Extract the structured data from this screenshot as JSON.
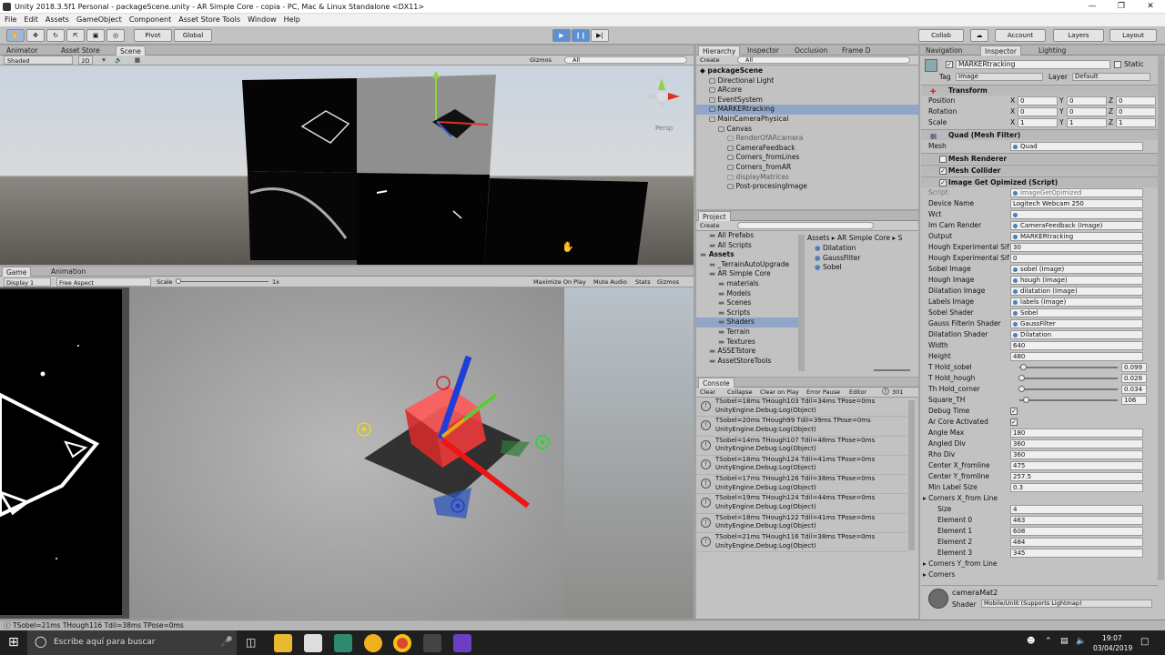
{
  "window": {
    "title": "Unity 2018.3.5f1 Personal - packageScene.unity - AR Simple Core - copia - PC, Mac & Linux Standalone <DX11>"
  },
  "menu": [
    "File",
    "Edit",
    "Assets",
    "GameObject",
    "Component",
    "Asset Store Tools",
    "Window",
    "Help"
  ],
  "toolbar": {
    "pivot": "Pivot",
    "global": "Global",
    "collab": "Collab",
    "account": "Account",
    "layers": "Layers",
    "layout": "Layout"
  },
  "scene_tabs": [
    "Animator",
    "Asset Store",
    "Scene"
  ],
  "scene_bar": {
    "shaded": "Shaded",
    "mode2d": "2D",
    "gizmos": "Gizmos",
    "search": "All"
  },
  "scene_gizmo": "Persp",
  "game_tabs": [
    "Game",
    "Animation"
  ],
  "game_bar": {
    "display": "Display 1",
    "aspect": "Free Aspect",
    "scale_label": "Scale",
    "scale_value": "1x",
    "max": "Maximize On Play",
    "mute": "Mute Audio",
    "stats": "Stats",
    "gizmos": "Gizmos"
  },
  "hier_tabs": [
    "Hierarchy",
    "Inspector",
    "Occlusion",
    "Frame D"
  ],
  "hier_create": "Create",
  "hier_search": "All",
  "hierarchy": [
    {
      "t": "packageScene",
      "d": 0,
      "bold": true
    },
    {
      "t": "Directional Light",
      "d": 1
    },
    {
      "t": "ARcore",
      "d": 1
    },
    {
      "t": "EventSystem",
      "d": 1
    },
    {
      "t": "MARKERtracking",
      "d": 1,
      "sel": true
    },
    {
      "t": "MainCameraPhysical",
      "d": 1
    },
    {
      "t": "Canvas",
      "d": 2
    },
    {
      "t": "RenderOfARcamera",
      "d": 3,
      "dim": true
    },
    {
      "t": "CameraFeedback",
      "d": 3
    },
    {
      "t": "Corners_fromLines",
      "d": 3
    },
    {
      "t": "Corners_fromAR",
      "d": 3
    },
    {
      "t": "displayMatrices",
      "d": 3,
      "dim": true
    },
    {
      "t": "Post-procesingImage",
      "d": 3
    }
  ],
  "project_tab": "Project",
  "project_create": "Create",
  "project_tree": [
    {
      "t": "All Prefabs",
      "d": 1
    },
    {
      "t": "All Scripts",
      "d": 1
    },
    {
      "t": "Assets",
      "d": 0,
      "bold": true
    },
    {
      "t": "_TerrainAutoUpgrade",
      "d": 1
    },
    {
      "t": "AR Simple Core",
      "d": 1
    },
    {
      "t": "materials",
      "d": 2
    },
    {
      "t": "Models",
      "d": 2
    },
    {
      "t": "Scenes",
      "d": 2
    },
    {
      "t": "Scripts",
      "d": 2
    },
    {
      "t": "Shaders",
      "d": 2,
      "sel": true
    },
    {
      "t": "Terrain",
      "d": 2
    },
    {
      "t": "Textures",
      "d": 2
    },
    {
      "t": "ASSETstore",
      "d": 1
    },
    {
      "t": "AssetStoreTools",
      "d": 1
    }
  ],
  "project_path": [
    "Assets",
    "AR Simple Core",
    "S"
  ],
  "project_files": [
    "Dilatation",
    "GaussFilter",
    "Sobel"
  ],
  "console_tab": "Console",
  "console_bar": {
    "clear": "Clear",
    "collapse": "Collapse",
    "clear_play": "Clear on Play",
    "error_pause": "Error Pause",
    "editor": "Editor",
    "count": "301"
  },
  "console_logs": [
    {
      "a": "TSobel=18ms THough103 Tdil=34ms TPose=0ms",
      "b": "UnityEngine.Debug:Log(Object)"
    },
    {
      "a": "TSobel=20ms THough99 Tdil=39ms TPose=0ms",
      "b": "UnityEngine.Debug:Log(Object)"
    },
    {
      "a": "TSobel=14ms THough107 Tdil=48ms TPose=0ms",
      "b": "UnityEngine.Debug:Log(Object)"
    },
    {
      "a": "TSobel=18ms THough124 Tdil=41ms TPose=0ms",
      "b": "UnityEngine.Debug:Log(Object)"
    },
    {
      "a": "TSobel=17ms THough126 Tdil=38ms TPose=0ms",
      "b": "UnityEngine.Debug:Log(Object)"
    },
    {
      "a": "TSobel=19ms THough124 Tdil=44ms TPose=0ms",
      "b": "UnityEngine.Debug:Log(Object)"
    },
    {
      "a": "TSobel=18ms THough122 Tdil=41ms TPose=0ms",
      "b": "UnityEngine.Debug:Log(Object)"
    },
    {
      "a": "TSobel=21ms THough116 Tdil=38ms TPose=0ms",
      "b": "UnityEngine.Debug:Log(Object)"
    }
  ],
  "insp_tabs": [
    "Navigation",
    "Inspector",
    "Lighting"
  ],
  "inspector": {
    "name": "MARKERtracking",
    "static": "Static",
    "tag_label": "Tag",
    "tag": "Image",
    "layer_label": "Layer",
    "layer": "Default",
    "transform": "Transform",
    "position_label": "Position",
    "rotation_label": "Rotation",
    "scale_label": "Scale",
    "position": [
      "0",
      "0",
      "0"
    ],
    "rotation": [
      "0",
      "0",
      "0"
    ],
    "scale": [
      "1",
      "1",
      "1"
    ],
    "mesh_filter": "Quad (Mesh Filter)",
    "mesh_label": "Mesh",
    "mesh": "Quad",
    "mesh_renderer": "Mesh Renderer",
    "mesh_collider": "Mesh Collider",
    "script_comp": "Image Get Opimized (Script)",
    "fields": [
      {
        "l": "Script",
        "v": "ImageGetOpimized",
        "obj": true,
        "dim": true
      },
      {
        "l": "Device Name",
        "v": "Logitech Webcam 250"
      },
      {
        "l": "Wct",
        "v": "",
        "obj": true
      },
      {
        "l": "Im Cam Render",
        "v": "CameraFeedback (Image)",
        "obj": true
      },
      {
        "l": "Output",
        "v": "MARKERtracking",
        "obj": true
      },
      {
        "l": "Hough Experimental Sif",
        "v": "30"
      },
      {
        "l": "Hough Experimental Sif",
        "v": "0"
      },
      {
        "l": "Sobel Image",
        "v": "sobel (Image)",
        "obj": true
      },
      {
        "l": "Hough Image",
        "v": "hough (Image)",
        "obj": true
      },
      {
        "l": "Dilatation Image",
        "v": "dilatation (Image)",
        "obj": true
      },
      {
        "l": "Labels Image",
        "v": "labels (Image)",
        "obj": true
      },
      {
        "l": "Sobel Shader",
        "v": "Sobel",
        "obj": true
      },
      {
        "l": "Gauss Filterin Shader",
        "v": "GaussFilter",
        "obj": true
      },
      {
        "l": "Dilatation Shader",
        "v": "Dilatation",
        "obj": true
      },
      {
        "l": "Width",
        "v": "640"
      },
      {
        "l": "Height",
        "v": "480"
      }
    ],
    "sliders": [
      {
        "l": "T Hold_sobel",
        "v": "0.099",
        "pos": 0.03
      },
      {
        "l": "T Hold_hough",
        "v": "0.028",
        "pos": 0.01
      },
      {
        "l": "Th Hold_corner",
        "v": "0.034",
        "pos": 0.01
      },
      {
        "l": "Square_TH",
        "v": "106",
        "pos": 0.06
      }
    ],
    "debug_time": "Debug Time",
    "ar_active": "Ar Core Activated",
    "fields2": [
      {
        "l": "Angle Max",
        "v": "180"
      },
      {
        "l": "Angled Div",
        "v": "360"
      },
      {
        "l": "Rho Div",
        "v": "360"
      },
      {
        "l": "Center X_fromline",
        "v": "475"
      },
      {
        "l": "Center Y_fromline",
        "v": "257.5"
      },
      {
        "l": "Min Label Size",
        "v": "0.3"
      }
    ],
    "corners_x": "Corners X_from Line",
    "corners_x_items": [
      {
        "l": "Size",
        "v": "4"
      },
      {
        "l": "Element 0",
        "v": "463"
      },
      {
        "l": "Element 1",
        "v": "608"
      },
      {
        "l": "Element 2",
        "v": "484"
      },
      {
        "l": "Element 3",
        "v": "345"
      }
    ],
    "corners_y": "Corners Y_from Line",
    "corners": "Corners",
    "material": "cameraMat2",
    "shader_label": "Shader",
    "shader": "Mobile/Unlit (Supports Lightmap)"
  },
  "status": "TSobel=21ms THough116 Tdil=38ms TPose=0ms",
  "taskbar": {
    "search": "Escribe aquí para buscar",
    "time": "19:07",
    "date": "03/04/2019"
  }
}
